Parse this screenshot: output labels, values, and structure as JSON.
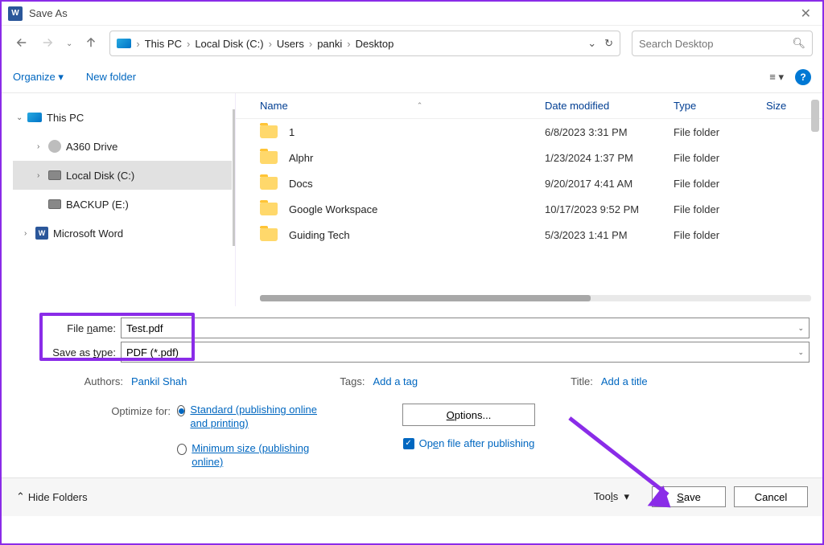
{
  "title": "Save As",
  "breadcrumb": [
    "This PC",
    "Local Disk (C:)",
    "Users",
    "panki",
    "Desktop"
  ],
  "search_placeholder": "Search Desktop",
  "toolbar": {
    "organize": "Organize",
    "new_folder": "New folder"
  },
  "sidebar": {
    "root": "This PC",
    "items": [
      {
        "label": "A360 Drive"
      },
      {
        "label": "Local Disk (C:)"
      },
      {
        "label": "BACKUP (E:)"
      },
      {
        "label": "Microsoft Word"
      }
    ]
  },
  "columns": {
    "name": "Name",
    "date": "Date modified",
    "type": "Type",
    "size": "Size"
  },
  "files": [
    {
      "name": "1",
      "date": "6/8/2023 3:31 PM",
      "type": "File folder"
    },
    {
      "name": "Alphr",
      "date": "1/23/2024 1:37 PM",
      "type": "File folder"
    },
    {
      "name": "Docs",
      "date": "9/20/2017 4:41 AM",
      "type": "File folder"
    },
    {
      "name": "Google Workspace",
      "date": "10/17/2023 9:52 PM",
      "type": "File folder"
    },
    {
      "name": "Guiding Tech",
      "date": "5/3/2023 1:41 PM",
      "type": "File folder"
    }
  ],
  "form": {
    "filename_label": "File name:",
    "filename_value": "Test.pdf",
    "type_label": "Save as type:",
    "type_value": "PDF (*.pdf)"
  },
  "meta": {
    "authors_label": "Authors:",
    "authors_value": "Pankil Shah",
    "tags_label": "Tags:",
    "tags_value": "Add a tag",
    "title_label": "Title:",
    "title_value": "Add a title"
  },
  "optimize": {
    "label": "Optimize for:",
    "standard": "Standard (publishing online and printing)",
    "minimum": "Minimum size (publishing online)",
    "options_btn": "Options...",
    "open_after": "Open file after publishing"
  },
  "footer": {
    "hide": "Hide Folders",
    "tools": "Tools",
    "save": "Save",
    "cancel": "Cancel"
  }
}
